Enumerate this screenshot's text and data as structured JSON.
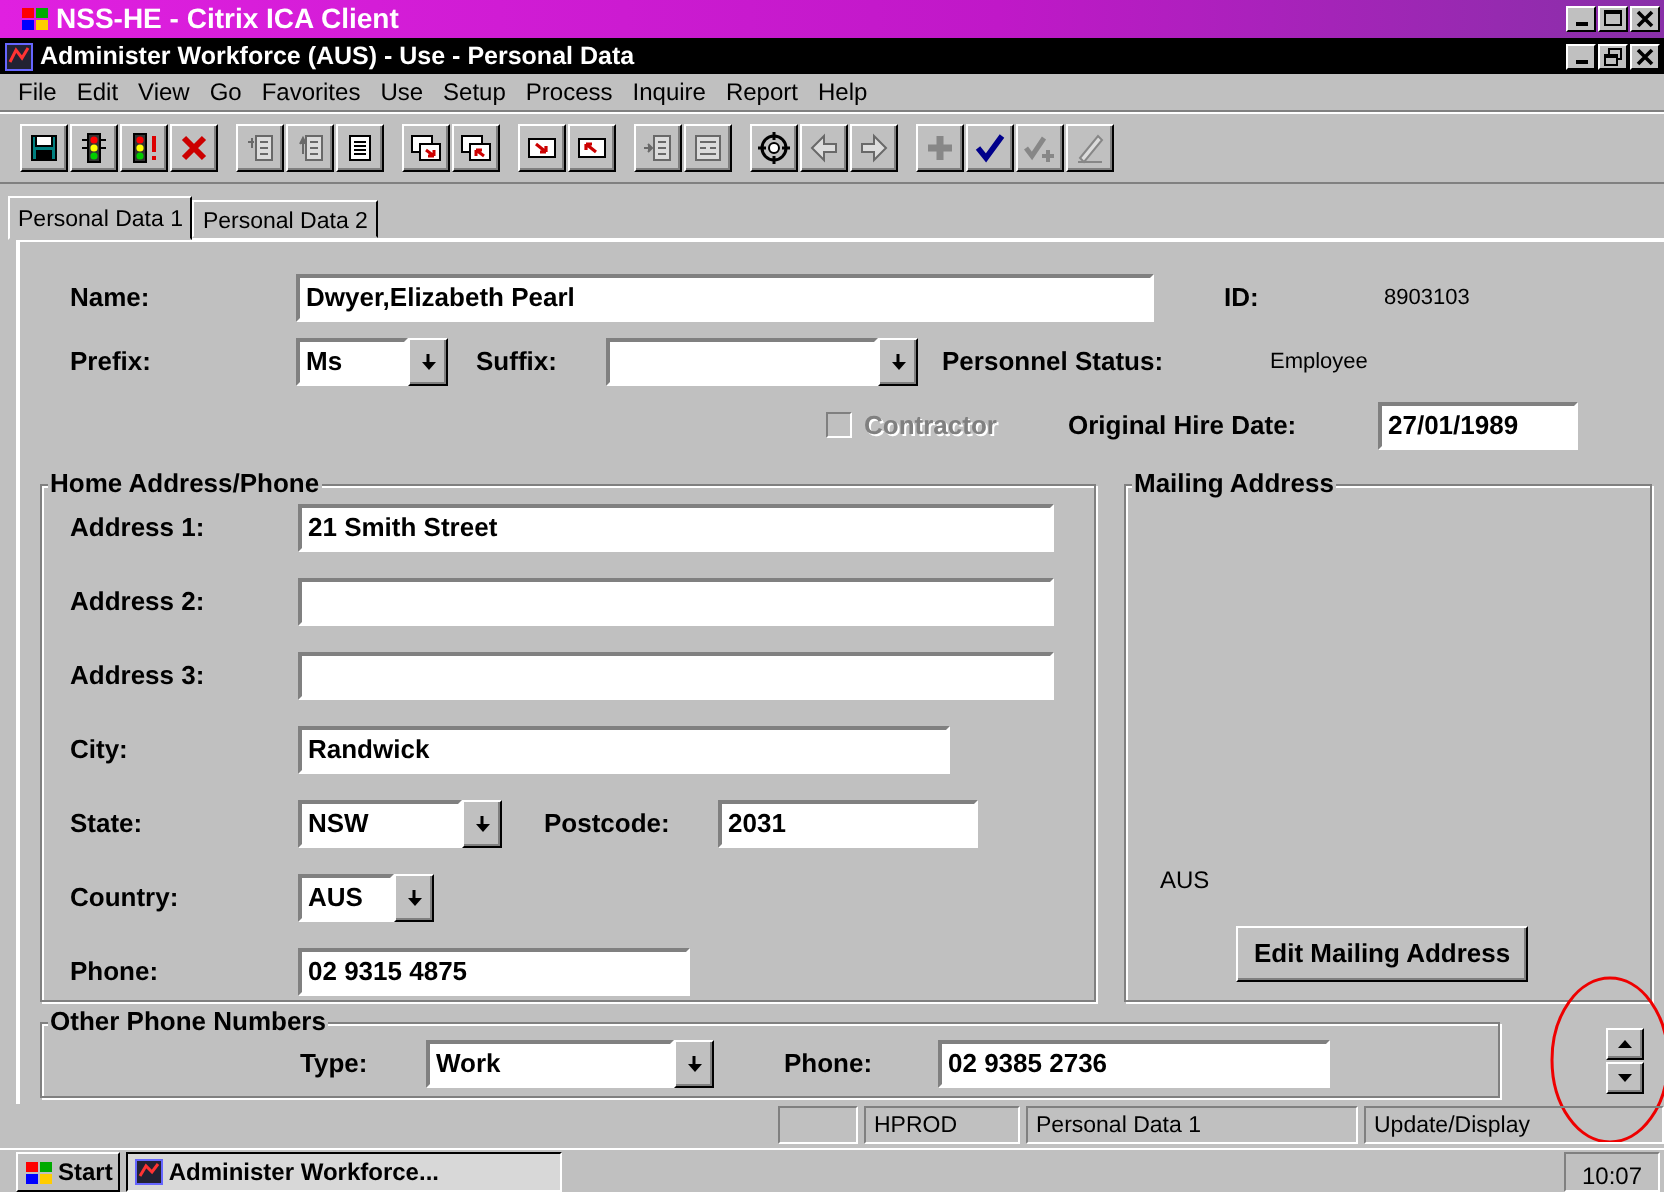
{
  "app_window": {
    "title": "NSS-HE - Citrix ICA Client"
  },
  "window": {
    "title": "Administer Workforce (AUS) - Use - Personal Data"
  },
  "menu": [
    {
      "label": "File"
    },
    {
      "label": "Edit"
    },
    {
      "label": "View"
    },
    {
      "label": "Go"
    },
    {
      "label": "Favorites"
    },
    {
      "label": "Use"
    },
    {
      "label": "Setup"
    },
    {
      "label": "Process"
    },
    {
      "label": "Inquire"
    },
    {
      "label": "Report"
    },
    {
      "label": "Help"
    }
  ],
  "toolbar": [
    [
      {
        "kind": "save",
        "disabled": false
      },
      {
        "kind": "signal",
        "disabled": false
      },
      {
        "kind": "signal-alert",
        "disabled": false
      },
      {
        "kind": "delete",
        "disabled": false
      }
    ],
    [
      {
        "kind": "list-in",
        "disabled": true
      },
      {
        "kind": "list-out",
        "disabled": true
      },
      {
        "kind": "list",
        "disabled": false
      }
    ],
    [
      {
        "kind": "window-in",
        "disabled": false
      },
      {
        "kind": "window-out",
        "disabled": false
      }
    ],
    [
      {
        "kind": "box-in",
        "disabled": false
      },
      {
        "kind": "box-out",
        "disabled": false
      }
    ],
    [
      {
        "kind": "list-next",
        "disabled": true
      },
      {
        "kind": "list-compare",
        "disabled": true
      }
    ],
    [
      {
        "kind": "target",
        "disabled": false
      },
      {
        "kind": "back",
        "disabled": true
      },
      {
        "kind": "forward",
        "disabled": true
      }
    ],
    [
      {
        "kind": "add",
        "disabled": true
      },
      {
        "kind": "check",
        "disabled": false
      },
      {
        "kind": "check-add",
        "disabled": true
      },
      {
        "kind": "edit",
        "disabled": true
      }
    ]
  ],
  "tabs": [
    {
      "label": "Personal Data 1",
      "selected": true
    },
    {
      "label": "Personal Data 2",
      "selected": false
    }
  ],
  "person": {
    "name_label": "Name:",
    "name": "Dwyer,Elizabeth Pearl",
    "id_label": "ID:",
    "id": "8903103",
    "prefix_label": "Prefix:",
    "prefix": "Ms",
    "suffix_label": "Suffix:",
    "status_label": "Personnel Status:",
    "status": "Employee",
    "contractor": {
      "label": "Contractor",
      "checked": false,
      "disabled": true
    },
    "hire_label": "Original Hire Date:",
    "hire_date": "27/01/1989"
  },
  "home_address": {
    "title": "Home Address/Phone",
    "address1_label": "Address 1:",
    "address1": "21 Smith Street",
    "address2_label": "Address 2:",
    "address3_label": "Address 3:",
    "city_label": "City:",
    "city": "Randwick",
    "state_label": "State:",
    "state": "NSW",
    "postcode_label": "Postcode:",
    "postcode": "2031",
    "country_label": "Country:",
    "country": "AUS",
    "phone_label": "Phone:",
    "phone": "02 9315 4875"
  },
  "mailing_address": {
    "title": "Mailing Address",
    "country": "AUS",
    "button": "Edit Mailing Address"
  },
  "other_phones": {
    "title": "Other Phone Numbers",
    "type_label": "Type:",
    "type": "Work",
    "phone_label": "Phone:",
    "phone": "02 9385 2736"
  },
  "status_bar": [
    "HPROD",
    "Personal Data 1",
    "Update/Display"
  ],
  "taskbar": {
    "start": "Start",
    "task": "Administer Workforce...",
    "clock": "10:07"
  }
}
